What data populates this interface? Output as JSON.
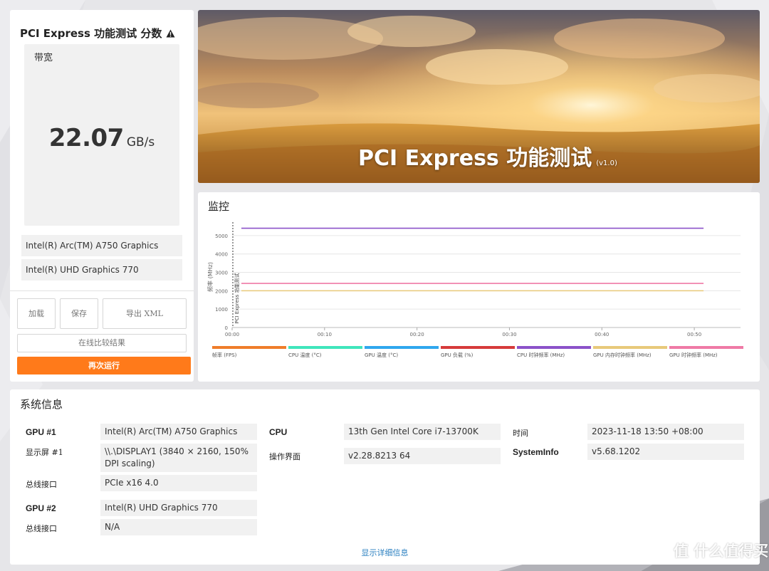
{
  "score": {
    "title": "PCI Express 功能测试 分数",
    "bandwidth_label": "带宽",
    "bandwidth_value": "22.07",
    "bandwidth_unit": "GB/s",
    "gpus": [
      "Intel(R) Arc(TM) A750 Graphics",
      "Intel(R) UHD Graphics 770"
    ],
    "buttons": {
      "load": "加载",
      "save": "保存",
      "export": "导出 XML",
      "compare": "在线比较结果",
      "run_again": "再次运行"
    }
  },
  "banner": {
    "title": "PCI Express 功能测试",
    "version": "(v1.0)"
  },
  "monitor": {
    "title": "监控"
  },
  "chart_data": {
    "type": "line",
    "ylabel": "频率 (MHz)",
    "ylim": [
      0,
      5500
    ],
    "y_ticks": [
      "0",
      "1000",
      "2000",
      "3000",
      "4000",
      "5000"
    ],
    "x_ticks": [
      "00:00",
      "00:10",
      "00:20",
      "00:30",
      "00:40",
      "00:50"
    ],
    "xlim": [
      0,
      55
    ],
    "marker_label": "PCI Express 功能测试",
    "series": [
      {
        "name": "帧率 (FPS)",
        "color": "#ef7d2a",
        "x": [],
        "y": []
      },
      {
        "name": "CPU 温度 (°C)",
        "color": "#3fe6bc",
        "x": [],
        "y": []
      },
      {
        "name": "GPU 温度 (°C)",
        "color": "#2fa7ee",
        "x": [],
        "y": []
      },
      {
        "name": "GPU 负载 (%)",
        "color": "#d63a3a",
        "x": [],
        "y": []
      },
      {
        "name": "CPU 时钟频率 (MHz)",
        "color": "#8b52c9",
        "x": [
          1,
          51
        ],
        "y": [
          5400,
          5400
        ]
      },
      {
        "name": "GPU 内存时钟频率 (MHz)",
        "color": "#e8c97a",
        "x": [
          1,
          51
        ],
        "y": [
          2000,
          2000
        ]
      },
      {
        "name": "GPU 时钟频率 (MHz)",
        "color": "#ef7aa6",
        "x": [
          1,
          51
        ],
        "y": [
          2400,
          2400
        ]
      }
    ]
  },
  "sysinfo": {
    "title": "系统信息",
    "gpu1_key": "GPU #1",
    "gpu1_val": "Intel(R) Arc(TM) A750 Graphics",
    "display1_key": "显示屏 #1",
    "display1_val": "\\\\.\\DISPLAY1 (3840 × 2160, 150% DPI scaling)",
    "bus1_key": "总线接口",
    "bus1_val": "PCIe x16 4.0",
    "gpu2_key": "GPU #2",
    "gpu2_val": "Intel(R) UHD Graphics 770",
    "bus2_key": "总线接口",
    "bus2_val": "N/A",
    "cpu_key": "CPU",
    "cpu_val": "13th Gen Intel Core i7-13700K",
    "os_key": "操作界面",
    "os_val": "v2.28.8213 64",
    "time_key": "时间",
    "time_val": "2023-11-18 13:50 +08:00",
    "sysinfo_key": "SystemInfo",
    "sysinfo_val": "v5.68.1202",
    "details_link": "显示详细信息"
  },
  "watermark": "值 什么值得买"
}
